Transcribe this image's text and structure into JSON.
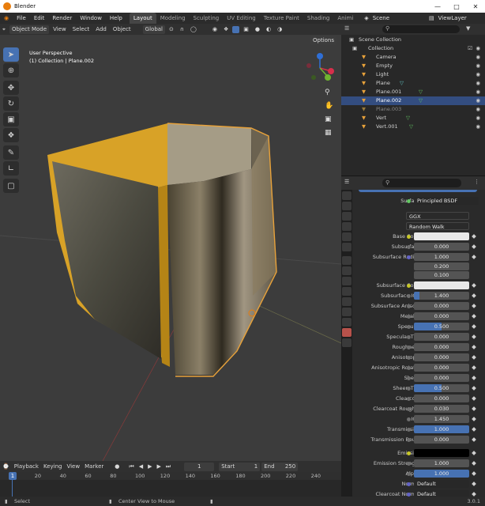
{
  "window": {
    "title": "Blender"
  },
  "menu": [
    "File",
    "Edit",
    "Render",
    "Window",
    "Help"
  ],
  "workspaces": [
    "Layout",
    "Modeling",
    "Sculpting",
    "UV Editing",
    "Texture Paint",
    "Shading",
    "Animi"
  ],
  "scene": {
    "name": "Scene",
    "view_layer": "ViewLayer"
  },
  "viewport_header": {
    "mode": "Object Mode",
    "view": "View",
    "select": "Select",
    "add": "Add",
    "object": "Object",
    "orientation": "Global",
    "options": "Options"
  },
  "viewport": {
    "perspective": "User Perspective",
    "collection": "(1) Collection | Plane.002"
  },
  "gizmo": {
    "x": "X",
    "y": "Y",
    "z": "Z"
  },
  "outliner": {
    "root": "Scene Collection",
    "collection": "Collection",
    "items": [
      "Camera",
      "Empty",
      "Light",
      "Plane",
      "Plane.001",
      "Plane.002",
      "Plane.003",
      "Vert",
      "Vert.001"
    ]
  },
  "properties": {
    "surface_label": "Surface",
    "surface_value": "Principled BSDF",
    "distribution": "GGX",
    "subsurface_method": "Random Walk",
    "rows": [
      {
        "label": "Base Color",
        "value": "",
        "type": "white",
        "dot": "yellow"
      },
      {
        "label": "Subsurface",
        "value": "0.000",
        "type": "grey",
        "dot": "grey"
      },
      {
        "label": "Subsurface Radius",
        "value": "1.000",
        "type": "grey",
        "dot": "purple"
      },
      {
        "label": "",
        "value": "0.200",
        "type": "grey",
        "dot": ""
      },
      {
        "label": "",
        "value": "0.100",
        "type": "grey",
        "dot": ""
      },
      {
        "label": "Subsurface Color",
        "value": "",
        "type": "white",
        "dot": "yellow"
      },
      {
        "label": "Subsurface IOR",
        "value": "1.400",
        "type": "grey",
        "dot": "grey"
      },
      {
        "label": "Subsurface Aniso...",
        "value": "0.000",
        "type": "grey",
        "dot": "grey"
      },
      {
        "label": "Metallic",
        "value": "0.000",
        "type": "grey",
        "dot": "grey"
      },
      {
        "label": "Specular",
        "value": "0.500",
        "type": "grey",
        "dot": "grey"
      },
      {
        "label": "Specular Tint",
        "value": "0.000",
        "type": "grey",
        "dot": "grey"
      },
      {
        "label": "Roughness",
        "value": "0.000",
        "type": "grey",
        "dot": "grey"
      },
      {
        "label": "Anisotropic",
        "value": "0.000",
        "type": "grey",
        "dot": "grey"
      },
      {
        "label": "Anisotropic Rotat...",
        "value": "0.000",
        "type": "grey",
        "dot": "grey"
      },
      {
        "label": "Sheen",
        "value": "0.000",
        "type": "grey",
        "dot": "grey"
      },
      {
        "label": "Sheen Tint",
        "value": "0.500",
        "type": "grey",
        "dot": "grey"
      },
      {
        "label": "Clearcoat",
        "value": "0.000",
        "type": "grey",
        "dot": "grey"
      },
      {
        "label": "Clearcoat Rough...",
        "value": "0.030",
        "type": "grey",
        "dot": "grey"
      },
      {
        "label": "IOR",
        "value": "1.450",
        "type": "grey",
        "dot": "grey"
      },
      {
        "label": "Transmission",
        "value": "1.000",
        "type": "blue",
        "dot": "grey"
      },
      {
        "label": "Transmission Rou...",
        "value": "0.000",
        "type": "grey",
        "dot": "grey"
      },
      {
        "label": "Emission",
        "value": "",
        "type": "black",
        "dot": "yellow"
      },
      {
        "label": "Emission Strength",
        "value": "1.000",
        "type": "grey",
        "dot": "grey"
      },
      {
        "label": "Alpha",
        "value": "1.000",
        "type": "blue",
        "dot": "grey"
      },
      {
        "label": "Normal",
        "value": "Default",
        "type": "dark",
        "dot": "purple"
      },
      {
        "label": "Clearcoat Normal",
        "value": "Default",
        "type": "dark",
        "dot": "purple"
      }
    ],
    "partial_fills": {
      "Subsurface IOR": 0.1,
      "Specular": 0.5,
      "Sheen Tint": 0.5
    }
  },
  "timeline": {
    "playback": "Playback",
    "keying": "Keying",
    "view": "View",
    "marker": "Marker",
    "current_frame": "1",
    "start_label": "Start",
    "start": "1",
    "end_label": "End",
    "end": "250",
    "ticks": [
      "1",
      "20",
      "40",
      "60",
      "80",
      "100",
      "120",
      "140",
      "160",
      "180",
      "200",
      "220",
      "240"
    ]
  },
  "status": {
    "select": "Select",
    "center": "Center View to Mouse",
    "version": "3.0.1"
  }
}
